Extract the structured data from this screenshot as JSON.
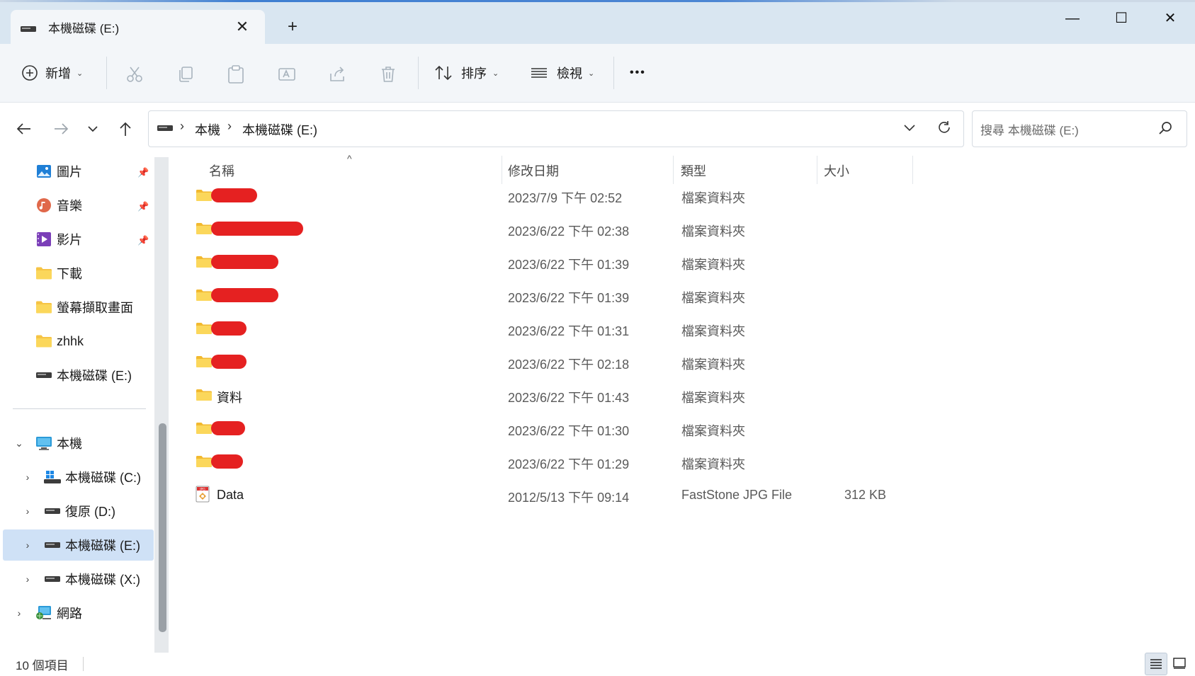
{
  "window": {
    "tab_title": "本機磁碟 (E:)",
    "new_tab_label": "+",
    "close_tab_label": "✕",
    "minimize_label": "—",
    "maximize_label": "☐",
    "close_label": "✕"
  },
  "toolbar": {
    "new_label": "新增",
    "sort_label": "排序",
    "view_label": "檢視",
    "more_label": "•••"
  },
  "address": {
    "crumbs": [
      "本機",
      "本機磁碟 (E:)"
    ],
    "separator": "›",
    "search_placeholder": "搜尋 本機磁碟 (E:)"
  },
  "sidebar": {
    "quick_access": [
      {
        "label": "圖片",
        "icon": "pictures-icon",
        "pinned": true
      },
      {
        "label": "音樂",
        "icon": "music-icon",
        "pinned": true
      },
      {
        "label": "影片",
        "icon": "videos-icon",
        "pinned": true
      },
      {
        "label": "下載",
        "icon": "folder-icon",
        "pinned": false
      },
      {
        "label": "螢幕擷取畫面",
        "icon": "folder-icon",
        "pinned": false
      },
      {
        "label": "zhhk",
        "icon": "folder-icon",
        "pinned": false
      },
      {
        "label": "本機磁碟 (E:)",
        "icon": "drive-icon",
        "pinned": false
      }
    ],
    "this_pc": "本機",
    "drives": [
      {
        "label": "本機磁碟 (C:)",
        "selected": false
      },
      {
        "label": "復原 (D:)",
        "selected": false
      },
      {
        "label": "本機磁碟 (E:)",
        "selected": true
      },
      {
        "label": "本機磁碟 (X:)",
        "selected": false
      }
    ],
    "network": "網路"
  },
  "columns": {
    "name": "名稱",
    "date": "修改日期",
    "type": "類型",
    "size": "大小"
  },
  "files": [
    {
      "name": "",
      "date": "2023/7/9 下午 02:52",
      "type": "檔案資料夾",
      "size": "",
      "kind": "folder",
      "redacted": true
    },
    {
      "name": "",
      "date": "2023/6/22 下午 02:38",
      "type": "檔案資料夾",
      "size": "",
      "kind": "folder",
      "redacted": true
    },
    {
      "name": "",
      "date": "2023/6/22 下午 01:39",
      "type": "檔案資料夾",
      "size": "",
      "kind": "folder",
      "redacted": true
    },
    {
      "name": "",
      "date": "2023/6/22 下午 01:39",
      "type": "檔案資料夾",
      "size": "",
      "kind": "folder",
      "redacted": true
    },
    {
      "name": "",
      "date": "2023/6/22 下午 01:31",
      "type": "檔案資料夾",
      "size": "",
      "kind": "folder",
      "redacted": true
    },
    {
      "name": "",
      "date": "2023/6/22 下午 02:18",
      "type": "檔案資料夾",
      "size": "",
      "kind": "folder",
      "redacted": true
    },
    {
      "name": "資料",
      "date": "2023/6/22 下午 01:43",
      "type": "檔案資料夾",
      "size": "",
      "kind": "folder",
      "redacted": false
    },
    {
      "name": "",
      "date": "2023/6/22 下午 01:30",
      "type": "檔案資料夾",
      "size": "",
      "kind": "folder",
      "redacted": true
    },
    {
      "name": "",
      "date": "2023/6/22 下午 01:29",
      "type": "檔案資料夾",
      "size": "",
      "kind": "folder",
      "redacted": true
    },
    {
      "name": "Data",
      "date": "2012/5/13 下午 09:14",
      "type": "FastStone JPG File",
      "size": "312 KB",
      "kind": "jpg",
      "redacted": false
    }
  ],
  "status": {
    "item_count": "10 個項目"
  },
  "colors": {
    "accent": "#1a73c7",
    "selected_bg": "#cfe1f6",
    "folder": "#f6c445",
    "redaction": "#e52121"
  }
}
